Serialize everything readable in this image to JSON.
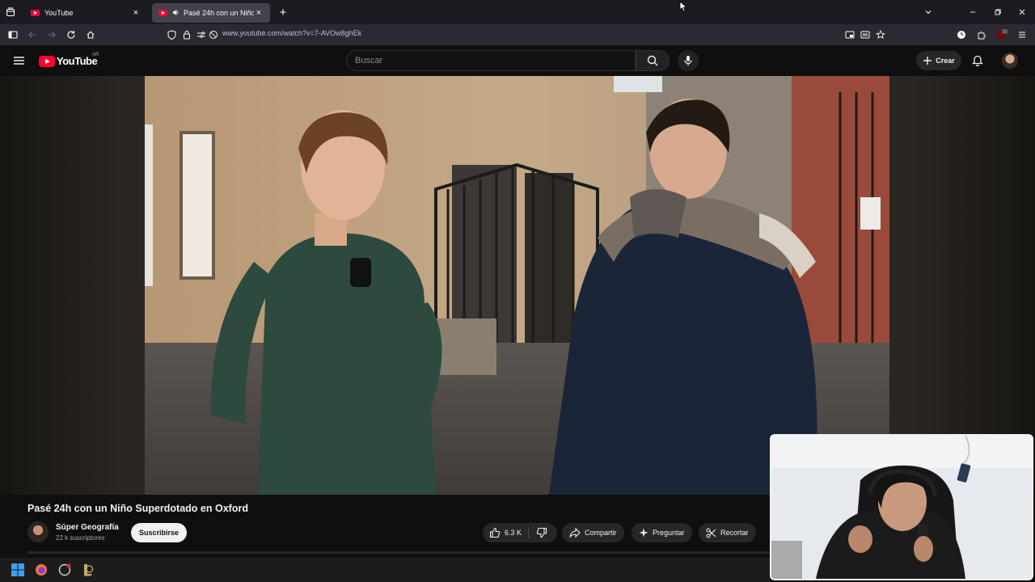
{
  "browser": {
    "tabs": [
      {
        "title": "YouTube",
        "active": false,
        "icon": "youtube-favicon"
      },
      {
        "title": "Pasé 24h con un Niño Superdotado en Oxford",
        "active": true,
        "icon": "youtube-favicon",
        "audio": true
      }
    ],
    "tab_close": "×",
    "new_tab": "+",
    "url": "www.youtube.com/watch?v=7-AVOw8ghEk",
    "extension_badge": "13"
  },
  "youtube": {
    "logo_text": "YouTube",
    "country_code": "AR",
    "search_placeholder": "Buscar",
    "create_label": "Crear"
  },
  "video": {
    "title": "Pasé 24h con un Niño Superdotado en Oxford",
    "channel_name": "Súper Geografía",
    "subscribers": "22 k suscriptores",
    "subscribe_label": "Suscribirse",
    "likes": "6.3 K",
    "share_label": "Compartir",
    "ask_label": "Preguntar",
    "clip_label": "Recortar"
  },
  "colors": {
    "youtube_red": "#ff0033",
    "page_bg": "#0f0f0f",
    "pill_bg": "#272727",
    "tab_active": "#42414d"
  }
}
